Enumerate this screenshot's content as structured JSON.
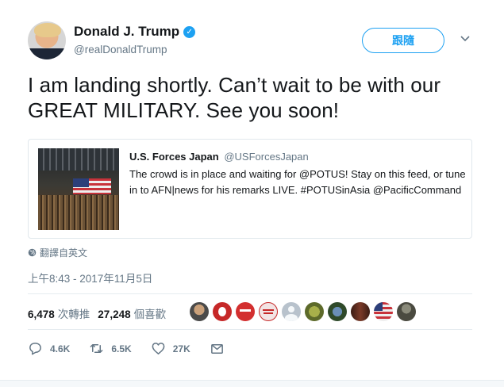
{
  "author": {
    "display_name": "Donald J. Trump",
    "handle": "@realDonaldTrump",
    "verified_icon": "verified-badge-icon"
  },
  "follow_label": "跟隨",
  "tweet_text": "I am landing shortly. Can’t wait to be with our GREAT MILITARY. See you soon!",
  "quote": {
    "display_name": "U.S. Forces Japan",
    "handle": "@USForcesJapan",
    "text": "The crowd is in place and waiting for @POTUS! Stay on this feed, or tune in to AFN|news for his remarks LIVE. #POTUSinAsia @PacificCommand"
  },
  "translate_label": "翻譯自英文",
  "timestamp": "上午8:43 - 2017年11月5日",
  "stats": {
    "retweets_count": "6,478",
    "retweets_label": "次轉推",
    "likes_count": "27,248",
    "likes_label": "個喜歡"
  },
  "actions": {
    "reply_count": "4.6K",
    "retweet_count": "6.5K",
    "like_count": "27K"
  },
  "colors": {
    "accent": "#1da1f2",
    "secondary_text": "#657786",
    "border": "#e1e8ed"
  }
}
